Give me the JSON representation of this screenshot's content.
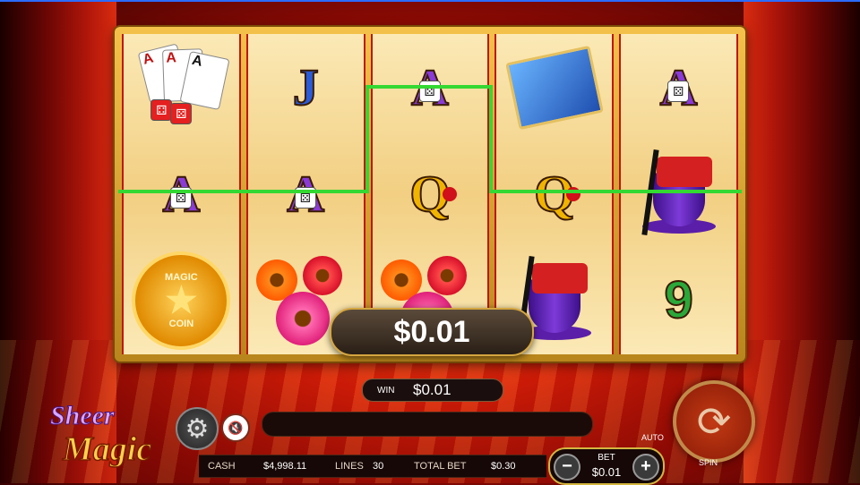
{
  "game": {
    "logo_line1": "Sheer",
    "logo_line2": "Magic"
  },
  "reels": [
    [
      "cards",
      "J",
      "A"
    ],
    [
      "A",
      "A",
      "book"
    ],
    [
      "A",
      "Q",
      "hat"
    ],
    [
      "book",
      "Q",
      "hat"
    ],
    [
      "A",
      "hat",
      "9"
    ]
  ],
  "symbols": {
    "J": "J",
    "A": "A",
    "Q": "Q",
    "nine": "9",
    "coin_text_top": "MAGIC",
    "coin_text_bottom": "COIN"
  },
  "win_overlay": "$0.01",
  "win_panel": {
    "label": "WIN",
    "value": "$0.01"
  },
  "bottom_bar": {
    "cash_label": "CASH",
    "cash_value": "$4,998.11",
    "lines_label": "LINES",
    "lines_value": "30",
    "total_bet_label": "TOTAL BET",
    "total_bet_value": "$0.30"
  },
  "bet": {
    "label": "BET",
    "value": "$0.01",
    "minus": "−",
    "plus": "+"
  },
  "auto_label": "AUTO",
  "spin_label": "SPIN",
  "icons": {
    "settings": "gear-icon",
    "sound": "speaker-muted-icon",
    "spin": "spin-arrows-icon"
  },
  "colors": {
    "payline": "#34d832",
    "frame": "#e0a93a",
    "reel_divider": "#c21508"
  }
}
